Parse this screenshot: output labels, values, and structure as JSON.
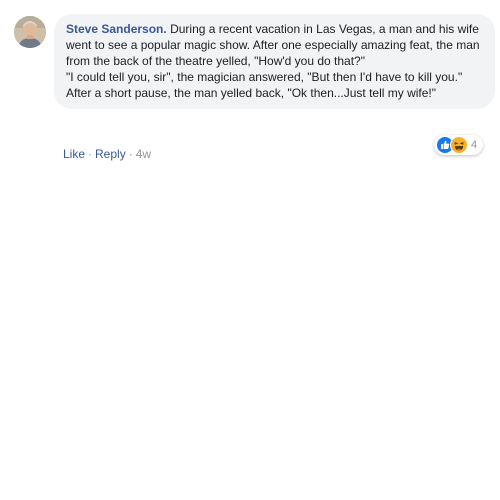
{
  "comment": {
    "author": "Steve Sanderson.",
    "body_lines": [
      "During a recent vacation in Las Vegas, a man and his wife went to see a popular magic show. After one especially amazing feat, the man from the back of the theatre yelled, \"How'd you do that?\"",
      "\"I could tell you, sir\", the magician answered, \"But then I'd have to kill you.\"",
      "After a short pause, the man yelled back, \"Ok then...Just tell my wife!\""
    ],
    "reactions": {
      "icons": [
        "like-icon",
        "haha-icon"
      ],
      "count": "4",
      "colors": {
        "like": "#1877f2",
        "haha": "#f7b125"
      }
    },
    "actions": {
      "like": "Like",
      "separator": "·",
      "reply": "Reply",
      "time": "4w"
    }
  },
  "colors": {
    "link": "#385898",
    "bubble_bg": "#f2f3f5",
    "meta": "#90949c",
    "text": "#1c1e21"
  }
}
